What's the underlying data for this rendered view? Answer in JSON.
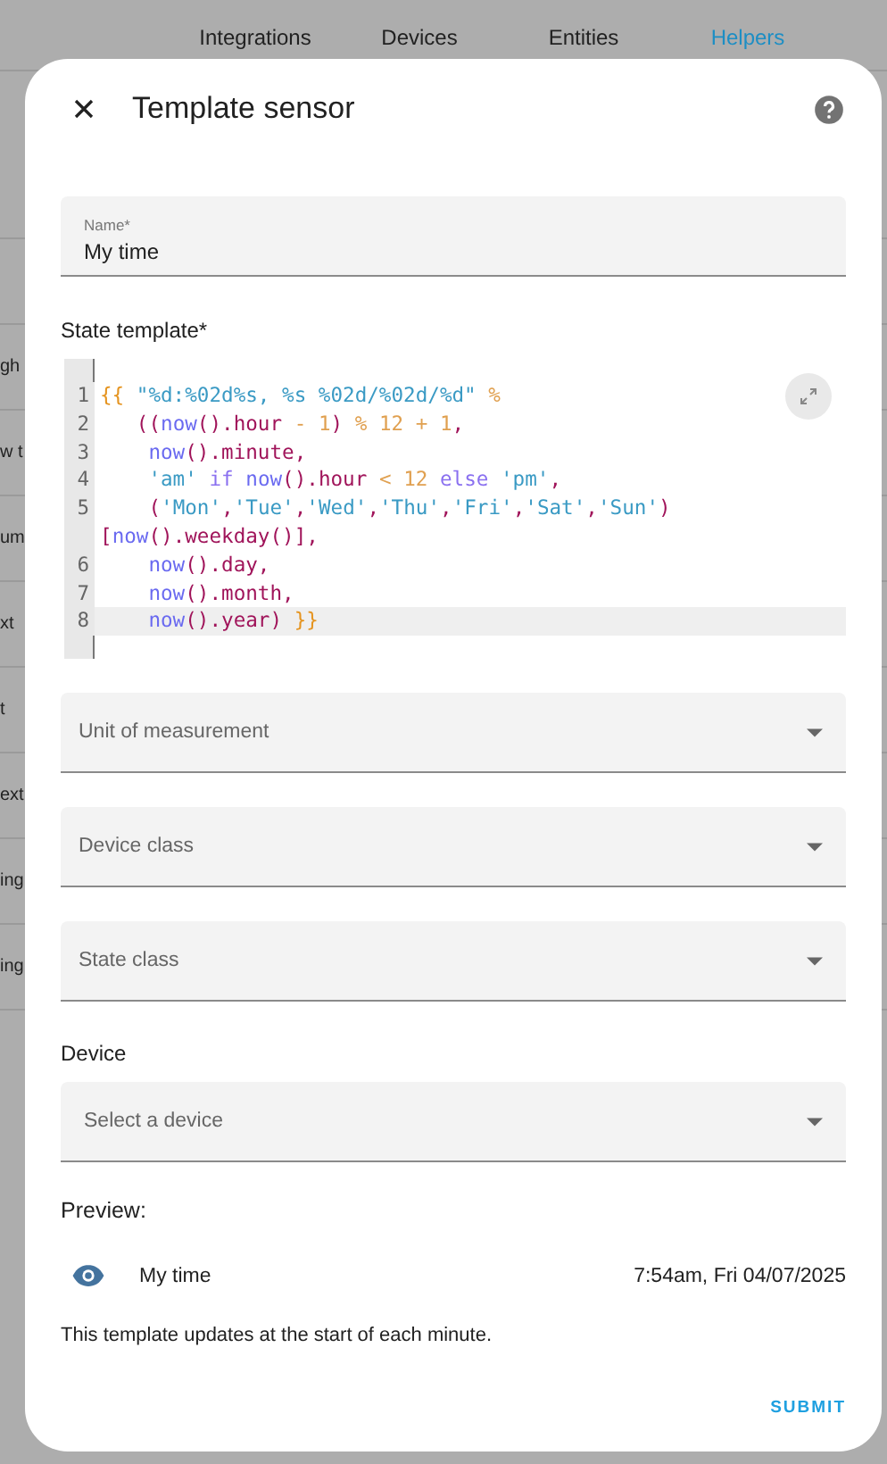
{
  "tabs": [
    {
      "label": "Integrations",
      "selected": false
    },
    {
      "label": "Devices",
      "selected": false
    },
    {
      "label": "Entities",
      "selected": false
    },
    {
      "label": "Helpers",
      "selected": true
    }
  ],
  "background_rows": [
    {
      "text": "gh"
    },
    {
      "text": "w t"
    },
    {
      "text": "um"
    },
    {
      "text": "xt"
    },
    {
      "text": "t"
    },
    {
      "text": "ext"
    },
    {
      "text": "ing"
    },
    {
      "text": "ing"
    }
  ],
  "dialog": {
    "title": "Template sensor",
    "name_field": {
      "label": "Name*",
      "value": "My time"
    },
    "state_template": {
      "label": "State template*",
      "lines": [
        {
          "number": "1",
          "active": false,
          "tokens": [
            {
              "text": "{{ ",
              "kind": "brace"
            },
            {
              "text": "\"%d:%02d%s, %s %02d/%02d/%d\"",
              "kind": "str"
            },
            {
              "text": " %",
              "kind": "op"
            }
          ]
        },
        {
          "number": "2",
          "active": false,
          "tokens": [
            {
              "text": "   ((",
              "kind": "punct"
            },
            {
              "text": "now",
              "kind": "fn"
            },
            {
              "text": "().hour ",
              "kind": "punct"
            },
            {
              "text": "- 1",
              "kind": "op"
            },
            {
              "text": ") ",
              "kind": "punct"
            },
            {
              "text": "% 12 + 1",
              "kind": "op"
            },
            {
              "text": ",",
              "kind": "punct"
            }
          ]
        },
        {
          "number": "3",
          "active": false,
          "tokens": [
            {
              "text": "    now",
              "kind": "fn"
            },
            {
              "text": "().minute,",
              "kind": "punct"
            }
          ]
        },
        {
          "number": "4",
          "active": false,
          "tokens": [
            {
              "text": "    'am'",
              "kind": "str"
            },
            {
              "text": " if ",
              "kind": "kw"
            },
            {
              "text": "now",
              "kind": "fn"
            },
            {
              "text": "().hour ",
              "kind": "punct"
            },
            {
              "text": "< 12",
              "kind": "op"
            },
            {
              "text": " else ",
              "kind": "kw"
            },
            {
              "text": "'pm'",
              "kind": "str"
            },
            {
              "text": ",",
              "kind": "punct"
            }
          ]
        },
        {
          "number": "5",
          "active": false,
          "tokens": [
            {
              "text": "    (",
              "kind": "punct"
            },
            {
              "text": "'Mon'",
              "kind": "str"
            },
            {
              "text": ",",
              "kind": "punct"
            },
            {
              "text": "'Tue'",
              "kind": "str"
            },
            {
              "text": ",",
              "kind": "punct"
            },
            {
              "text": "'Wed'",
              "kind": "str"
            },
            {
              "text": ",",
              "kind": "punct"
            },
            {
              "text": "'Thu'",
              "kind": "str"
            },
            {
              "text": ",",
              "kind": "punct"
            },
            {
              "text": "'Fri'",
              "kind": "str"
            },
            {
              "text": ",",
              "kind": "punct"
            },
            {
              "text": "'Sat'",
              "kind": "str"
            },
            {
              "text": ",",
              "kind": "punct"
            },
            {
              "text": "'Sun'",
              "kind": "str"
            },
            {
              "text": ")",
              "kind": "punct"
            }
          ]
        },
        {
          "active": false,
          "tokens": [
            {
              "text": "[",
              "kind": "punct"
            },
            {
              "text": "now",
              "kind": "fn"
            },
            {
              "text": "().weekday()],",
              "kind": "punct"
            }
          ]
        },
        {
          "number": "6",
          "active": false,
          "tokens": [
            {
              "text": "    now",
              "kind": "fn"
            },
            {
              "text": "().day,",
              "kind": "punct"
            }
          ]
        },
        {
          "number": "7",
          "active": false,
          "tokens": [
            {
              "text": "    now",
              "kind": "fn"
            },
            {
              "text": "().month,",
              "kind": "punct"
            }
          ]
        },
        {
          "number": "8",
          "active": true,
          "tokens": [
            {
              "text": "    now",
              "kind": "fn"
            },
            {
              "text": "().year) ",
              "kind": "punct"
            },
            {
              "text": "}}",
              "kind": "brace"
            }
          ]
        }
      ]
    },
    "selects": [
      {
        "label": "Unit of measurement"
      },
      {
        "label": "Device class"
      },
      {
        "label": "State class"
      }
    ],
    "device": {
      "label": "Device",
      "placeholder": "Select a device"
    },
    "preview": {
      "heading": "Preview:",
      "entity": "My time",
      "state": "7:54am, Fri 04/07/2025",
      "note": "This template updates at the start of each minute."
    },
    "submit": "SUBMIT"
  }
}
